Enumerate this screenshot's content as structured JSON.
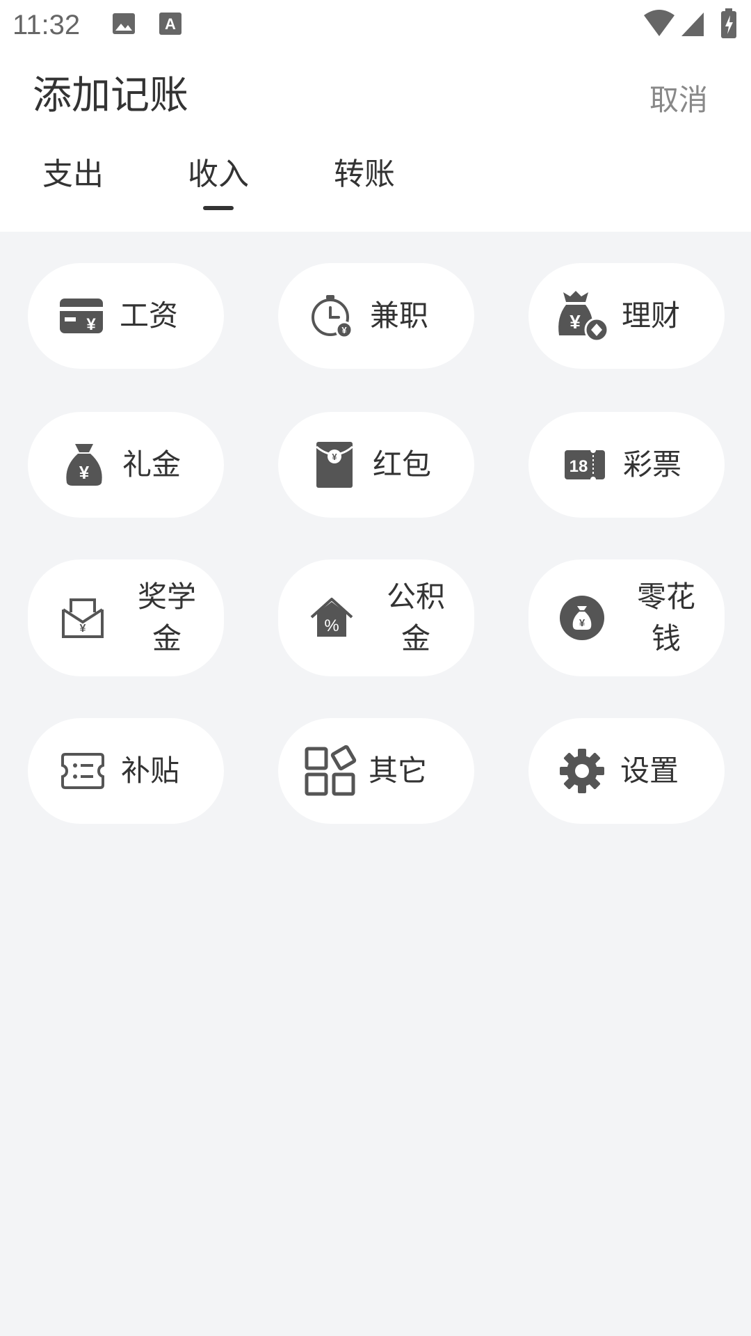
{
  "status_bar": {
    "time": "11:32"
  },
  "header": {
    "title": "添加记账",
    "cancel_label": "取消"
  },
  "tabs": [
    {
      "label": "支出",
      "selected": false
    },
    {
      "label": "收入",
      "selected": true
    },
    {
      "label": "转账",
      "selected": false
    }
  ],
  "categories": [
    {
      "label": "工资",
      "icon": "salary-card-icon"
    },
    {
      "label": "兼职",
      "icon": "clock-money-icon"
    },
    {
      "label": "理财",
      "icon": "money-bag-icon"
    },
    {
      "label": "礼金",
      "icon": "gift-bag-icon"
    },
    {
      "label": "红包",
      "icon": "red-envelope-icon"
    },
    {
      "label": "彩票",
      "icon": "lottery-ticket-icon"
    },
    {
      "label": "奖学金",
      "icon": "scholarship-icon"
    },
    {
      "label": "公积金",
      "icon": "housing-fund-icon"
    },
    {
      "label": "零花钱",
      "icon": "pocket-money-icon"
    },
    {
      "label": "补贴",
      "icon": "subsidy-icon"
    },
    {
      "label": "其它",
      "icon": "other-grid-icon"
    },
    {
      "label": "设置",
      "icon": "gear-icon"
    }
  ],
  "colors": {
    "background": "#f3f4f6",
    "surface": "#ffffff",
    "icon": "#555555",
    "text": "#333333",
    "muted": "#888888"
  }
}
